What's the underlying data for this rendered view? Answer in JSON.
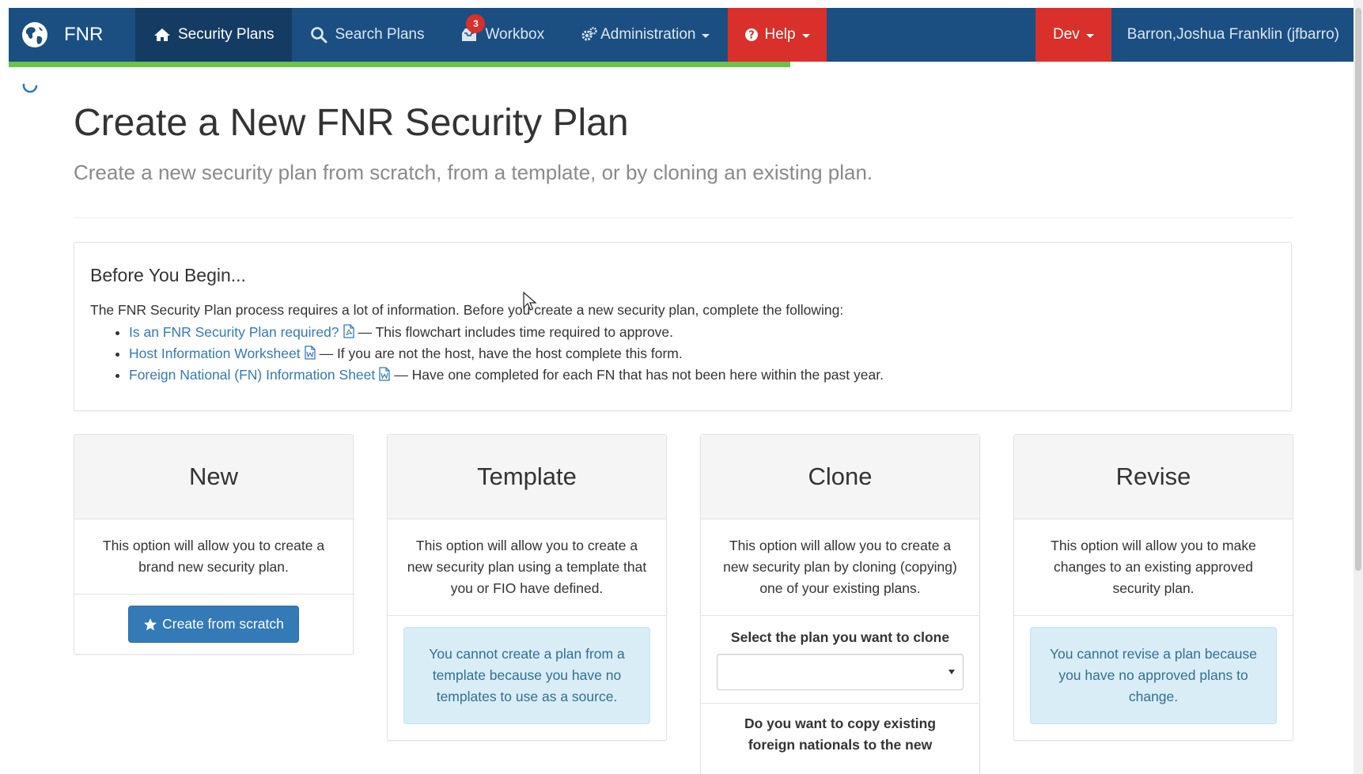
{
  "navbar": {
    "brand": "FNR",
    "items": [
      {
        "label": "Security Plans",
        "icon": "home-icon",
        "active": true
      },
      {
        "label": "Search Plans",
        "icon": "search-icon"
      },
      {
        "label": "Workbox",
        "icon": "inbox-icon",
        "badge": "3"
      },
      {
        "label": "Administration",
        "icon": "cogs-icon",
        "dropdown": true
      },
      {
        "label": "Help",
        "icon": "question-circle-icon",
        "dropdown": true
      }
    ],
    "env": "Dev",
    "user": "Barron,Joshua Franklin (jfbarro)",
    "accent_color": "#1b4f82",
    "alert_color": "#d9302b",
    "progress_color": "#6cc24a"
  },
  "header": {
    "title": "Create a New FNR Security Plan",
    "subtitle": "Create a new security plan from scratch, from a template, or by cloning an existing plan."
  },
  "before": {
    "heading": "Before You Begin...",
    "intro": "The FNR Security Plan process requires a lot of information. Before you create a new security plan, complete the following:",
    "items": [
      {
        "link": "Is an FNR Security Plan required?",
        "icon": "pdf-file-icon",
        "text": "— This flowchart includes time required to approve."
      },
      {
        "link": "Host Information Worksheet",
        "icon": "word-file-icon",
        "text": "— If you are not the host, have the host complete this form."
      },
      {
        "link": "Foreign National (FN) Information Sheet",
        "icon": "word-file-icon",
        "text": "— Have one completed for each FN that has not been here within the past year."
      }
    ]
  },
  "cards": {
    "new": {
      "title": "New",
      "desc": "This option will allow you to create a brand new security plan.",
      "button": "Create from scratch"
    },
    "template": {
      "title": "Template",
      "desc": "This option will allow you to create a new security plan using a template that you or FIO have defined.",
      "alert": "You cannot create a plan from a template because you have no templates to use as a source."
    },
    "clone": {
      "title": "Clone",
      "desc": "This option will allow you to create a new security plan by cloning (copying) one of your existing plans.",
      "select_label": "Select the plan you want to clone",
      "select_value": "",
      "question": "Do you want to copy existing foreign nationals to the new"
    },
    "revise": {
      "title": "Revise",
      "desc": "This option will allow you to make changes to an existing approved security plan.",
      "alert": "You cannot revise a plan because you have no approved plans to change."
    }
  }
}
